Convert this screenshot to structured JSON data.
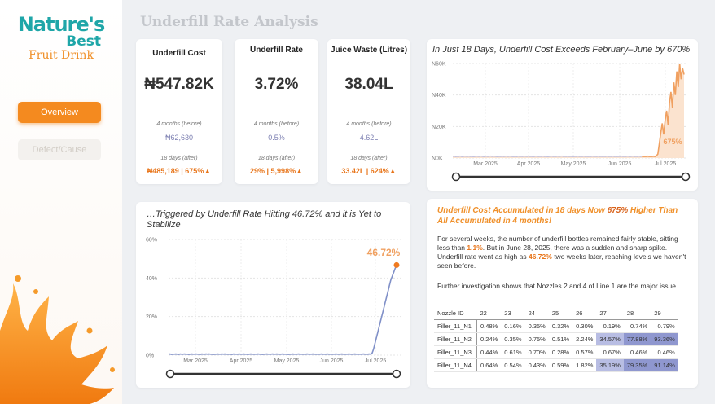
{
  "brand": {
    "word1": "Nature's",
    "word2": "Best",
    "sub": "Fruit Drink"
  },
  "nav": [
    {
      "label": "Overview",
      "active": true
    },
    {
      "label": "Defect/Cause",
      "active": false
    }
  ],
  "page_title": "Underfill Rate Analysis",
  "kpis": [
    {
      "title": "Underfill Cost",
      "value": "₦547.82K",
      "before_label": "4 months (before)",
      "before_value": "₦62,630",
      "after_label": "18 days (after)",
      "after_value": "₦485,189 | 675%▲"
    },
    {
      "title": "Underfill Rate",
      "value": "3.72%",
      "before_label": "4 months (before)",
      "before_value": "0.5%",
      "after_label": "18 days (after)",
      "after_value": "29% | 5,998%▲"
    },
    {
      "title": "Juice Waste (Litres)",
      "value": "38.04L",
      "before_label": "4 months (before)",
      "before_value": "4.62L",
      "after_label": "18 days (after)",
      "after_value": "33.42L | 624%▲"
    }
  ],
  "chart_data": [
    {
      "type": "area",
      "title": "In Just 18 Days, Underfill Cost Exceeds February–June by 670%",
      "x_ticks": [
        "Mar 2025",
        "Apr 2025",
        "May 2025",
        "Jun 2025",
        "Jul 2025"
      ],
      "y_ticks": [
        "N0K",
        "N20K",
        "N40K",
        "N60K"
      ],
      "ylim": [
        0,
        60000
      ],
      "annotation": "675%",
      "series_color": "#f0a060",
      "values": [
        1000,
        1200,
        900,
        1100,
        1000,
        1300,
        1000,
        900,
        1200,
        1100,
        1000,
        1200,
        1000,
        1100,
        900,
        1000,
        1200,
        1100,
        1000,
        1300,
        1100,
        1000,
        900,
        1200,
        1000,
        1100,
        1300,
        1000,
        1200,
        1100,
        1000,
        900,
        1100,
        1000,
        1200,
        1000,
        1100,
        1300,
        1000,
        1200,
        1100,
        1000,
        1000,
        1100,
        900,
        1200,
        1000,
        1100,
        1000,
        1200,
        1100,
        1000,
        1300,
        1000,
        1100,
        900,
        1000,
        1200,
        1100,
        1000,
        1100,
        1000,
        1200,
        1000,
        1100,
        900,
        1000,
        1100,
        1200,
        1000,
        1100,
        1000,
        1200,
        1000,
        1100,
        1300,
        1000,
        1100,
        1000,
        1200,
        1000,
        1100,
        1000,
        900,
        1100,
        1000,
        1200,
        1000,
        1100,
        1000,
        1200,
        1000,
        1100,
        1000,
        1100,
        1000,
        1200,
        1000,
        1100,
        1000,
        1200,
        1000,
        1100,
        1000,
        1100,
        1000,
        1200,
        1000,
        1100,
        1000,
        1200,
        1000,
        1100,
        1000,
        1100,
        1000,
        1200,
        1000,
        1100,
        1000,
        1200,
        1100,
        1000,
        1100,
        1200,
        1000,
        1100,
        1000,
        1200,
        1000,
        1100,
        1000,
        1100,
        1000,
        1200,
        1000,
        1100,
        1000,
        1200,
        1000,
        1500,
        2500,
        9000,
        16000,
        22000,
        15000,
        24000,
        30000,
        21000,
        35000,
        42000,
        32000,
        48000,
        40000,
        55000,
        45000,
        60000,
        50000,
        57000,
        53000
      ]
    },
    {
      "type": "line",
      "title": "…Triggered by Underfill Rate Hitting 46.72% and it is Yet to Stabilize",
      "x_ticks": [
        "Mar 2025",
        "Apr 2025",
        "May 2025",
        "Jun 2025",
        "Jul 2025"
      ],
      "y_ticks": [
        "0%",
        "20%",
        "40%",
        "60%"
      ],
      "ylim": [
        0,
        60
      ],
      "annotation": "46.72%",
      "series_color": "#8090c8",
      "values": [
        0.5,
        0.6,
        0.4,
        0.5,
        0.5,
        0.6,
        0.5,
        0.4,
        0.6,
        0.5,
        0.5,
        0.6,
        0.5,
        0.5,
        0.4,
        0.5,
        0.6,
        0.5,
        0.5,
        0.6,
        0.5,
        0.5,
        0.4,
        0.6,
        0.5,
        0.5,
        0.6,
        0.5,
        0.6,
        0.5,
        0.5,
        0.4,
        0.5,
        0.5,
        0.6,
        0.5,
        0.5,
        0.6,
        0.5,
        0.6,
        0.5,
        0.5,
        0.5,
        0.5,
        0.4,
        0.6,
        0.5,
        0.5,
        0.5,
        0.6,
        0.5,
        0.5,
        0.6,
        0.5,
        0.5,
        0.4,
        0.5,
        0.6,
        0.5,
        0.5,
        0.5,
        0.5,
        0.6,
        0.5,
        0.5,
        0.4,
        0.5,
        0.5,
        0.6,
        0.5,
        0.5,
        0.5,
        0.6,
        0.5,
        0.5,
        0.6,
        0.5,
        0.5,
        0.5,
        0.6,
        0.5,
        0.5,
        0.5,
        0.4,
        0.5,
        0.5,
        0.6,
        0.5,
        0.5,
        0.5,
        0.6,
        0.5,
        0.5,
        0.5,
        0.5,
        0.5,
        0.6,
        0.5,
        0.5,
        0.5,
        0.6,
        0.5,
        0.5,
        0.5,
        0.5,
        0.5,
        0.6,
        0.5,
        0.5,
        0.5,
        0.6,
        0.5,
        0.5,
        0.5,
        0.5,
        0.5,
        0.6,
        0.5,
        0.5,
        0.5,
        0.6,
        0.5,
        0.5,
        0.5,
        0.5,
        0.6,
        0.5,
        0.5,
        0.5,
        0.6,
        0.5,
        0.5,
        0.5,
        0.5,
        0.5,
        0.6,
        0.5,
        0.5,
        0.5,
        0.6,
        0.5,
        1,
        3,
        6,
        9,
        12,
        15,
        18,
        21,
        24,
        27,
        30,
        33,
        36,
        39,
        41,
        43,
        45,
        46.72
      ]
    }
  ],
  "insight": {
    "headline_pre": "Underfill Cost Accumulated in 18 days Now ",
    "headline_pct": "675%",
    "headline_post": " Higher Than All Accumulated in 4 months!",
    "p1_a": "For several weeks, the number of underfill bottles remained fairly stable, sitting less than ",
    "p1_b": "1.1%",
    "p1_c": ". But in June 28, 2025, there was a sudden and sharp spike. Underfill rate went as high as ",
    "p1_d": "46.72%",
    "p1_e": " two weeks later, reaching levels we haven't seen before.",
    "p2": "Further investigation shows that Nozzles 2 and 4 of Line 1 are the major issue."
  },
  "nozzle_table": {
    "headers": [
      "Nozzle ID",
      "22",
      "23",
      "24",
      "25",
      "26",
      "27",
      "28",
      "29"
    ],
    "rows": [
      [
        "Filler_11_N1",
        "0.48%",
        "0.16%",
        "0.35%",
        "0.32%",
        "0.30%",
        "0.19%",
        "0.74%",
        "0.79%"
      ],
      [
        "Filler_11_N2",
        "0.24%",
        "0.35%",
        "0.75%",
        "0.51%",
        "2.24%",
        "34.57%",
        "77.88%",
        "93.36%"
      ],
      [
        "Filler_11_N3",
        "0.44%",
        "0.61%",
        "0.70%",
        "0.28%",
        "0.57%",
        "0.67%",
        "0.46%",
        "0.46%"
      ],
      [
        "Filler_11_N4",
        "0.64%",
        "0.54%",
        "0.43%",
        "0.59%",
        "1.82%",
        "35.19%",
        "79.35%",
        "91.14%"
      ]
    ]
  }
}
